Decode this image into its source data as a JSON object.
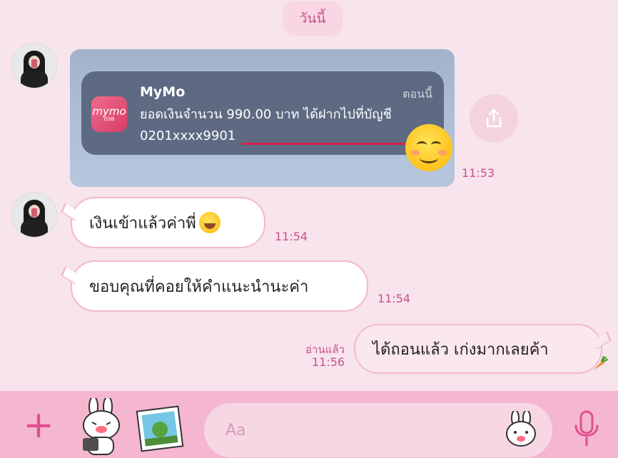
{
  "date_badge": "วันนี้",
  "notification": {
    "app_name": "MyMo",
    "time": "ตอนนี้",
    "body_line1": "ยอดเงินจำนวน 990.00 บาท ได้ฝากไปที่บัญชี",
    "body_line2": "0201xxxx9901",
    "icon_logo": "mymo",
    "icon_sub": "GSB"
  },
  "messages": {
    "image_time": "11:53",
    "msg1_text": "เงินเข้าแล้วค่าพี่",
    "msg1_time": "11:54",
    "msg2_text": "ขอบคุณที่คอยให้คำแนะนำนะค่า",
    "msg2_time": "11:54",
    "msg3_read": "อ่านแล้ว",
    "msg3_time": "11:56",
    "msg3_text": "ได้ถอนแล้ว เก่งมากเลยค้า"
  },
  "input": {
    "placeholder": "Aa"
  },
  "icons": {
    "plus": "plus-icon",
    "share": "share-icon",
    "mic": "mic-icon"
  },
  "colors": {
    "accent": "#e04f8e",
    "bubble_border": "#f3b8cf",
    "time": "#c9518a",
    "toolbar": "#f4b7cf"
  }
}
